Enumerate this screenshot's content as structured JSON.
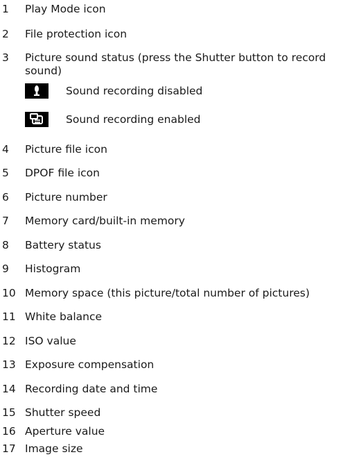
{
  "items": [
    {
      "num": "1",
      "text": "Play Mode icon"
    },
    {
      "num": "2",
      "text": "File protection icon"
    },
    {
      "num": "3",
      "text": "Picture sound status (press the Shutter button to record sound)"
    },
    {
      "num": "4",
      "text": "Picture file icon"
    },
    {
      "num": "5",
      "text": "DPOF file icon"
    },
    {
      "num": "6",
      "text": "Picture number"
    },
    {
      "num": "7",
      "text": "Memory card/built-in memory"
    },
    {
      "num": "8",
      "text": "Battery status"
    },
    {
      "num": "9",
      "text": "Histogram"
    },
    {
      "num": "10",
      "text": "Memory space (this picture/total number of pictures)"
    },
    {
      "num": "11",
      "text": "White balance"
    },
    {
      "num": "12",
      "text": "ISO value"
    },
    {
      "num": "13",
      "text": "Exposure compensation"
    },
    {
      "num": "14",
      "text": "Recording date and time"
    },
    {
      "num": "15",
      "text": "Shutter speed"
    },
    {
      "num": "16",
      "text": "Aperture value"
    },
    {
      "num": "17",
      "text": "Image size"
    }
  ],
  "sound_states": [
    {
      "icon": "microphone-disabled-icon",
      "label": "Sound recording disabled"
    },
    {
      "icon": "sound-recording-enabled-icon",
      "label": "Sound recording enabled"
    }
  ]
}
